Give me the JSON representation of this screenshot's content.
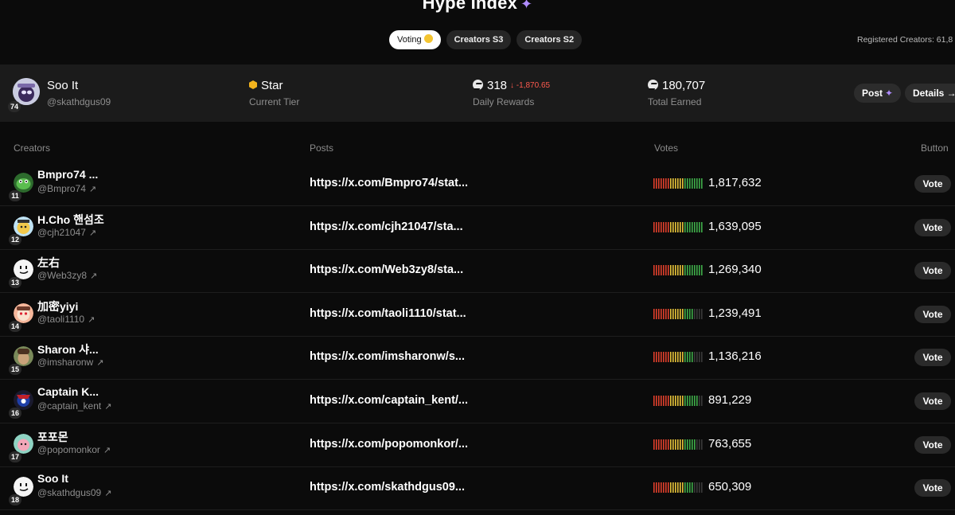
{
  "header": {
    "title": "Hype Index",
    "registered": "Registered Creators: 61,8"
  },
  "tabs": [
    {
      "label": "Voting",
      "active": true
    },
    {
      "label": "Creators S3",
      "active": false
    },
    {
      "label": "Creators S2",
      "active": false
    }
  ],
  "user": {
    "name": "Soo It",
    "handle": "@skathdgus09",
    "rank": "74",
    "tier_value": "Star",
    "tier_label": "Current Tier",
    "daily_value": "318",
    "daily_delta": "↓ -1,870.65",
    "daily_label": "Daily Rewards",
    "total_value": "180,707",
    "total_label": "Total Earned",
    "post_label": "Post",
    "details_label": "Details →"
  },
  "columns": {
    "creators": "Creators",
    "posts": "Posts",
    "votes": "Votes",
    "button": "Button"
  },
  "rows": [
    {
      "rank": "11",
      "name": "Bmpro74 ...",
      "handle": "@Bmpro74",
      "post": "https://x.com/Bmpro74/stat...",
      "votes": "1,817,632",
      "vote_label": "Vote",
      "bar_level": 1.0
    },
    {
      "rank": "12",
      "name": "H.Cho 핸섬조",
      "handle": "@cjh21047",
      "post": "https://x.com/cjh21047/sta...",
      "votes": "1,639,095",
      "vote_label": "Vote",
      "bar_level": 1.0
    },
    {
      "rank": "13",
      "name": "左右",
      "handle": "@Web3zy8",
      "post": "https://x.com/Web3zy8/sta...",
      "votes": "1,269,340",
      "vote_label": "Vote",
      "bar_level": 1.0
    },
    {
      "rank": "14",
      "name": "加密yiyi",
      "handle": "@taoli1110",
      "post": "https://x.com/taoli1110/stat...",
      "votes": "1,239,491",
      "vote_label": "Vote",
      "bar_level": 0.8
    },
    {
      "rank": "15",
      "name": "Sharon 샤...",
      "handle": "@imsharonw",
      "post": "https://x.com/imsharonw/s...",
      "votes": "1,136,216",
      "vote_label": "Vote",
      "bar_level": 0.8
    },
    {
      "rank": "16",
      "name": "Captain K...",
      "handle": "@captain_kent",
      "post": "https://x.com/captain_kent/...",
      "votes": "891,229",
      "vote_label": "Vote",
      "bar_level": 0.9
    },
    {
      "rank": "17",
      "name": "포포몬",
      "handle": "@popomonkor",
      "post": "https://x.com/popomonkor/...",
      "votes": "763,655",
      "vote_label": "Vote",
      "bar_level": 0.85
    },
    {
      "rank": "18",
      "name": "Soo It",
      "handle": "@skathdgus09",
      "post": "https://x.com/skathdgus09...",
      "votes": "650,309",
      "vote_label": "Vote",
      "bar_level": 0.8
    }
  ],
  "colors": {
    "accent": "#b08cff",
    "delta": "#ff5a4e",
    "bar_red": "#e0402c",
    "bar_yellow": "#e8c53a",
    "bar_green": "#3fae4a",
    "tier": "#f2b31d"
  }
}
